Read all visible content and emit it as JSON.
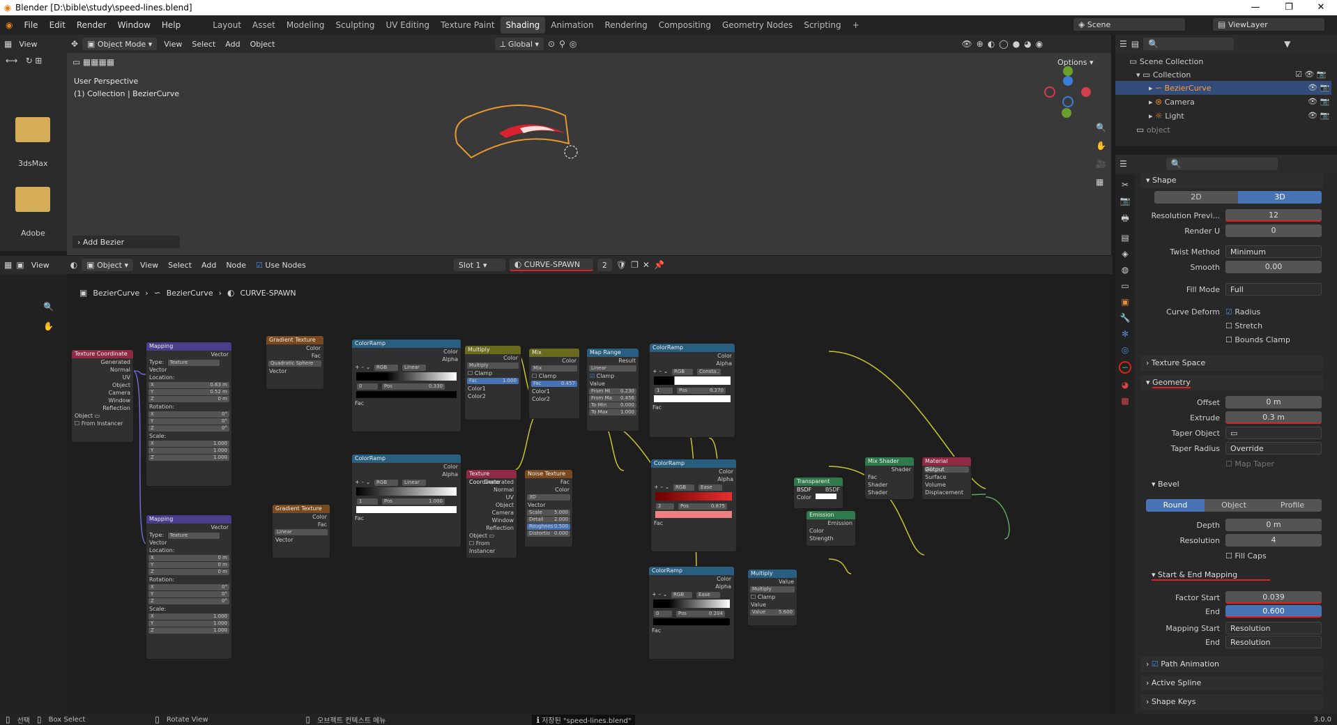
{
  "titlebar": {
    "title": "Blender [D:\\bible\\study\\speed-lines.blend]"
  },
  "menus": [
    "File",
    "Edit",
    "Render",
    "Window",
    "Help"
  ],
  "workspaces": [
    "Layout",
    "Asset",
    "Modeling",
    "Sculpting",
    "UV Editing",
    "Texture Paint",
    "Shading",
    "Animation",
    "Rendering",
    "Compositing",
    "Geometry Nodes",
    "Scripting"
  ],
  "topright": {
    "scene": "Scene",
    "viewlayer": "ViewLayer"
  },
  "viewport": {
    "mode": "Object Mode",
    "view": "View",
    "select": "Select",
    "add": "Add",
    "object": "Object",
    "orientation": "Global",
    "options": "Options",
    "perspective": "User Perspective",
    "collection": "(1) Collection | BezierCurve",
    "add_bezier": "Add Bezier"
  },
  "filebrowser": {
    "items": [
      "3dsMax",
      "Adobe"
    ]
  },
  "outliner": {
    "scene_collection": "Scene Collection",
    "collection": "Collection",
    "items": [
      "BezierCurve",
      "Camera",
      "Light"
    ],
    "object": "object"
  },
  "nodeeditor": {
    "object": "Object",
    "view": "View",
    "select": "Select",
    "add": "Add",
    "node": "Node",
    "use_nodes": "Use Nodes",
    "slot": "Slot 1",
    "material": "CURVE-SPAWN",
    "users": "2",
    "breadcrumb": [
      "BezierCurve",
      "BezierCurve",
      "CURVE-SPAWN"
    ]
  },
  "nodes": {
    "texcoord": {
      "title": "Texture Coordinate",
      "outs": [
        "Generated",
        "Normal",
        "UV",
        "Object",
        "Camera",
        "Window",
        "Reflection"
      ],
      "object": "Object",
      "from_instancer": "From Instancer"
    },
    "mapping1": {
      "title": "Mapping",
      "vector": "Vector",
      "type": "Type:",
      "type_val": "Texture",
      "vec_in": "Vector",
      "location": "Location:",
      "lx": "0.63 m",
      "ly": "0.52 m",
      "lz": "0 m",
      "rotation": "Rotation:",
      "rx": "0°",
      "ry": "0°",
      "rz": "0°",
      "scale": "Scale:",
      "sx": "1.000",
      "sy": "1.000",
      "sz": "1.000"
    },
    "mapping2": {
      "title": "Mapping",
      "vector": "Vector",
      "type": "Type:",
      "type_val": "Texture",
      "vec_in": "Vector",
      "location": "Location:",
      "lx": "0 m",
      "ly": "0 m",
      "lz": "0 m",
      "rotation": "Rotation:",
      "rx": "0°",
      "ry": "0°",
      "rz": "0°",
      "scale": "Scale:",
      "sx": "1.000",
      "sy": "1.000",
      "sz": "1.000"
    },
    "grad1": {
      "title": "Gradient Texture",
      "color": "Color",
      "fac": "Fac",
      "type": "Quadratic Sphere",
      "vector": "Vector"
    },
    "grad2": {
      "title": "Gradient Texture",
      "color": "Color",
      "fac": "Fac",
      "type": "Linear",
      "vector": "Vector"
    },
    "cr1": {
      "title": "ColorRamp",
      "color": "Color",
      "alpha": "Alpha",
      "mode": "RGB",
      "interp": "Linear",
      "idx": "0",
      "pos": "Pos",
      "posv": "0.330",
      "fac": "Fac"
    },
    "cr2": {
      "title": "ColorRamp",
      "color": "Color",
      "alpha": "Alpha",
      "mode": "RGB",
      "interp": "Linear",
      "idx": "1",
      "pos": "Pos",
      "posv": "1.000",
      "fac": "Fac"
    },
    "multiply": {
      "title": "Multiply",
      "color": "Color",
      "type": "Multiply",
      "clamp": "Clamp",
      "fac": "Fac",
      "facv": "1.000",
      "c1": "Color1",
      "c2": "Color2"
    },
    "mix": {
      "title": "Mix",
      "color": "Color",
      "type": "Mix",
      "clamp": "Clamp",
      "fac": "Fac",
      "facv": "0.457",
      "c1": "Color1",
      "c2": "Color2"
    },
    "maprange": {
      "title": "Map Range",
      "result": "Result",
      "type": "Linear",
      "clamp": "Clamp",
      "value": "Value",
      "fmin": "From Mi",
      "fminv": "0.230",
      "fmax": "From Ma",
      "fmaxv": "0.456",
      "tmin": "To Min",
      "tminv": "0.000",
      "tmax": "To Max",
      "tmaxv": "1.000"
    },
    "texcoord2": {
      "title": "Texture Coordinate",
      "outs": [
        "Generated",
        "Normal",
        "UV",
        "Object",
        "Camera",
        "Window",
        "Reflection"
      ],
      "object": "Object",
      "from_instancer": "From Instancer"
    },
    "noise": {
      "title": "Noise Texture",
      "fac": "Fac",
      "color": "Color",
      "dim": "3D",
      "vector": "Vector",
      "scale": "Scale",
      "scalev": "5.000",
      "detail": "Detail",
      "detailv": "2.000",
      "rough": "Roughnes",
      "roughv": "0.500",
      "dist": "Distortio",
      "distv": "0.000"
    },
    "cr3": {
      "title": "ColorRamp",
      "color": "Color",
      "alpha": "Alpha",
      "mode": "RGB",
      "interp": "Consta..",
      "idx": "1",
      "pos": "Pos",
      "posv": "0.270",
      "fac": "Fac"
    },
    "cr4": {
      "title": "ColorRamp",
      "color": "Color",
      "alpha": "Alpha",
      "mode": "RGB",
      "interp": "Ease",
      "idx": "2",
      "pos": "Pos",
      "posv": "0.875",
      "fac": "Fac"
    },
    "cr5": {
      "title": "ColorRamp",
      "color": "Color",
      "alpha": "Alpha",
      "mode": "RGB",
      "interp": "Ease",
      "idx": "0",
      "pos": "Pos",
      "posv": "0.204",
      "fac": "Fac"
    },
    "multiply2": {
      "title": "Multiply",
      "value": "Value",
      "type": "Multiply",
      "clamp": "Clamp",
      "vin": "Value",
      "vval": "Value",
      "vvalv": "5.600"
    },
    "transparent": {
      "title": "Transparent BSDF",
      "bsdf": "BSDF",
      "color": "Color"
    },
    "emission": {
      "title": "Emission",
      "emission": "Emission",
      "color": "Color",
      "strength": "Strength"
    },
    "mixshader": {
      "title": "Mix Shader",
      "shader": "Shader",
      "fac": "Fac",
      "s1": "Shader",
      "s2": "Shader"
    },
    "output": {
      "title": "Material Output",
      "target": "All",
      "surface": "Surface",
      "volume": "Volume",
      "displacement": "Displacement"
    }
  },
  "props": {
    "shape": "Shape",
    "d2": "2D",
    "d3": "3D",
    "res_prev_l": "Resolution Previ...",
    "res_prev": "12",
    "render_u_l": "Render U",
    "render_u": "0",
    "twist_l": "Twist Method",
    "twist": "Minimum",
    "smooth_l": "Smooth",
    "smooth": "0.00",
    "fill_l": "Fill Mode",
    "fill": "Full",
    "deform_l": "Curve Deform",
    "radius": "Radius",
    "stretch": "Stretch",
    "bounds": "Bounds Clamp",
    "texspace": "Texture Space",
    "geometry": "Geometry",
    "offset_l": "Offset",
    "offset": "0 m",
    "extrude_l": "Extrude",
    "extrude": "0.3 m",
    "taper_obj_l": "Taper Object",
    "taper_rad_l": "Taper Radius",
    "taper_rad": "Override",
    "map_taper": "Map Taper",
    "bevel": "Bevel",
    "round": "Round",
    "objectb": "Object",
    "profile": "Profile",
    "depth_l": "Depth",
    "depth": "0 m",
    "resolution_l": "Resolution",
    "resolution": "4",
    "fill_caps": "Fill Caps",
    "sem": "Start & End Mapping",
    "fstart_l": "Factor Start",
    "fstart": "0.039",
    "end_l": "End",
    "end": "0.600",
    "mapstart_l": "Mapping Start",
    "mapstart": "Resolution",
    "end2_l": "End",
    "end2": "Resolution",
    "path_anim": "Path Animation",
    "active_spline": "Active Spline",
    "shape_keys": "Shape Keys"
  },
  "statusbar": {
    "select": "선택",
    "box": "Box Select",
    "rotate": "Rotate View",
    "ctx": "오브젝트 컨텍스트 메뉴",
    "saved": "저장된 \"speed-lines.blend\"",
    "version": "3.0.0"
  }
}
